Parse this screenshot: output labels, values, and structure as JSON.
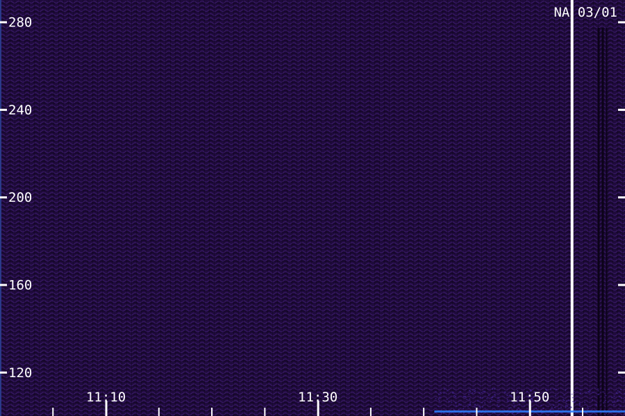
{
  "chart_data": {
    "type": "heatmap",
    "title": "",
    "annotation": "NA 03/01",
    "xlabel": "",
    "ylabel": "",
    "x_ticks": [
      "11:10",
      "11:30",
      "11:50"
    ],
    "y_ticks": [
      120,
      160,
      200,
      240,
      280
    ],
    "xlim": [
      "11:00",
      "11:59"
    ],
    "ylim": [
      100,
      290
    ],
    "grid": false,
    "colors": {
      "background": "#1f0b3c",
      "texture_light": "#3a1a6a",
      "texture_dark": "#0c0318",
      "signal_low": "#4a2aa8",
      "signal_high": "#2f7fff",
      "axis": "#ffffff"
    },
    "features": [
      {
        "kind": "vertical_line",
        "time": "11:54",
        "color": "#ffffff"
      },
      {
        "kind": "dark_band",
        "time": "11:57"
      },
      {
        "kind": "low_frequency_activity",
        "from": "11:41",
        "to": "11:59"
      }
    ]
  }
}
